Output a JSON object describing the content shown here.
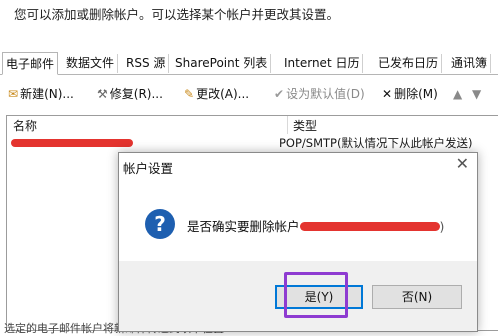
{
  "description": "您可以添加或删除帐户。可以选择某个帐户并更改其设置。",
  "tabs": [
    {
      "label": "电子邮件",
      "active": true
    },
    {
      "label": "数据文件",
      "active": false
    },
    {
      "label": "RSS 源",
      "active": false
    },
    {
      "label": "SharePoint 列表",
      "active": false
    },
    {
      "label": "Internet 日历",
      "active": false
    },
    {
      "label": "已发布日历",
      "active": false
    },
    {
      "label": "通讯簿",
      "active": false
    }
  ],
  "toolbar": {
    "new_label": "新建(N)...",
    "repair_label": "修复(R)...",
    "change_label": "更改(A)...",
    "set_default_label": "设为默认值(D)",
    "delete_label": "删除(M)"
  },
  "list": {
    "col_name": "名称",
    "col_type": "类型",
    "row_type": "POP/SMTP(默认情况下从此帐户发送)"
  },
  "dialog": {
    "title": "帐户设置",
    "message": "是否确实要删除帐户",
    "message_suffix": ")",
    "yes_label": "是(Y)",
    "no_label": "否(N)"
  },
  "bottom_text": "选定的电子邮件帐户将新邮件传递到以下位置",
  "colors": {
    "redaction": "#e4342f",
    "highlight": "#8e3bd1",
    "accent": "#0078d7",
    "question_icon": "#1e5fb0"
  }
}
